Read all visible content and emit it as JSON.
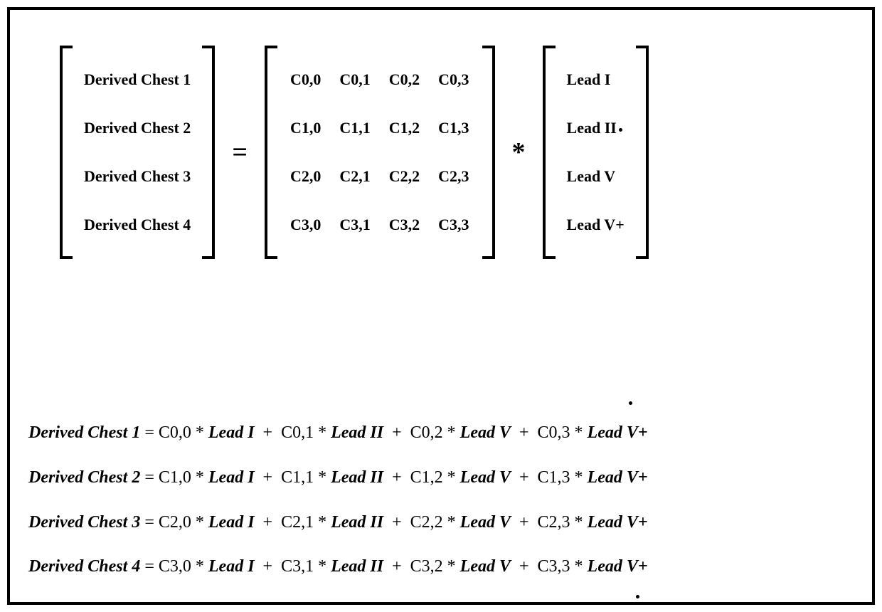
{
  "result_vector": [
    "Derived Chest 1",
    "Derived Chest 2",
    "Derived Chest 3",
    "Derived Chest 4"
  ],
  "coeff_matrix": [
    [
      "C0,0",
      "C0,1",
      "C0,2",
      "C0,3"
    ],
    [
      "C1,0",
      "C1,1",
      "C1,2",
      "C1,3"
    ],
    [
      "C2,0",
      "C2,1",
      "C2,2",
      "C2,3"
    ],
    [
      "C3,0",
      "C3,1",
      "C3,2",
      "C3,3"
    ]
  ],
  "lead_vector": [
    "Lead I",
    "Lead II",
    "Lead V",
    "Lead V+"
  ],
  "ops": {
    "equals": "=",
    "times": "*",
    "plus": "+"
  },
  "equations": [
    {
      "lhs": "Derived Chest 1",
      "terms": [
        {
          "c": "C0,0",
          "l": "Lead I"
        },
        {
          "c": "C0,1",
          "l": "Lead II"
        },
        {
          "c": "C0,2",
          "l": "Lead V"
        },
        {
          "c": "C0,3",
          "l": "Lead V+"
        }
      ]
    },
    {
      "lhs": "Derived Chest 2",
      "terms": [
        {
          "c": "C1,0",
          "l": "Lead I"
        },
        {
          "c": "C1,1",
          "l": "Lead II"
        },
        {
          "c": "C1,2",
          "l": "Lead V"
        },
        {
          "c": "C1,3",
          "l": "Lead V+"
        }
      ]
    },
    {
      "lhs": "Derived Chest 3",
      "terms": [
        {
          "c": "C2,0",
          "l": "Lead I"
        },
        {
          "c": "C2,1",
          "l": "Lead II"
        },
        {
          "c": "C2,2",
          "l": "Lead V"
        },
        {
          "c": "C2,3",
          "l": "Lead V+"
        }
      ]
    },
    {
      "lhs": "Derived Chest 4",
      "terms": [
        {
          "c": "C3,0",
          "l": "Lead I"
        },
        {
          "c": "C3,1",
          "l": "Lead II"
        },
        {
          "c": "C3,2",
          "l": "Lead V"
        },
        {
          "c": "C3,3",
          "l": "Lead V+"
        }
      ]
    }
  ]
}
